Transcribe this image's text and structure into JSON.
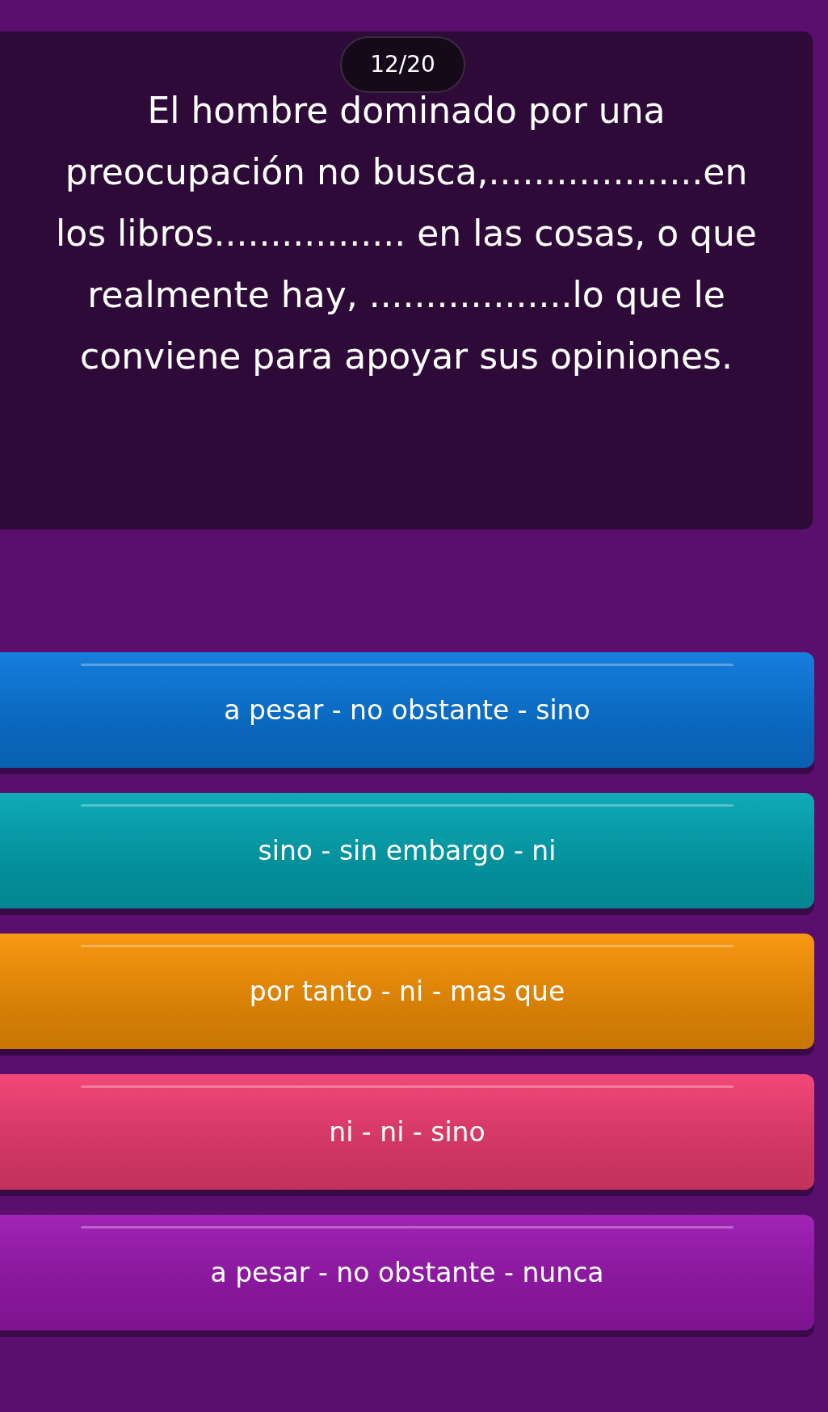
{
  "progress": "12/20",
  "question": "El hombre dominado por una preocupación no busca,...................en los libros................. en las cosas, o que realmente hay, ..................lo que le conviene para apoyar sus opiniones.",
  "options": [
    {
      "label": "a pesar - no obstante - sino",
      "color": "#0b78dc"
    },
    {
      "label": "sino - sin embargo - ni",
      "color": "#03a7b4"
    },
    {
      "label": "por tanto - ni - mas que",
      "color": "#f99406"
    },
    {
      "label": "ni - ni - sino",
      "color": "#f23f72"
    },
    {
      "label": "a pesar - no obstante - nunca",
      "color": "#9d1ab3"
    }
  ]
}
